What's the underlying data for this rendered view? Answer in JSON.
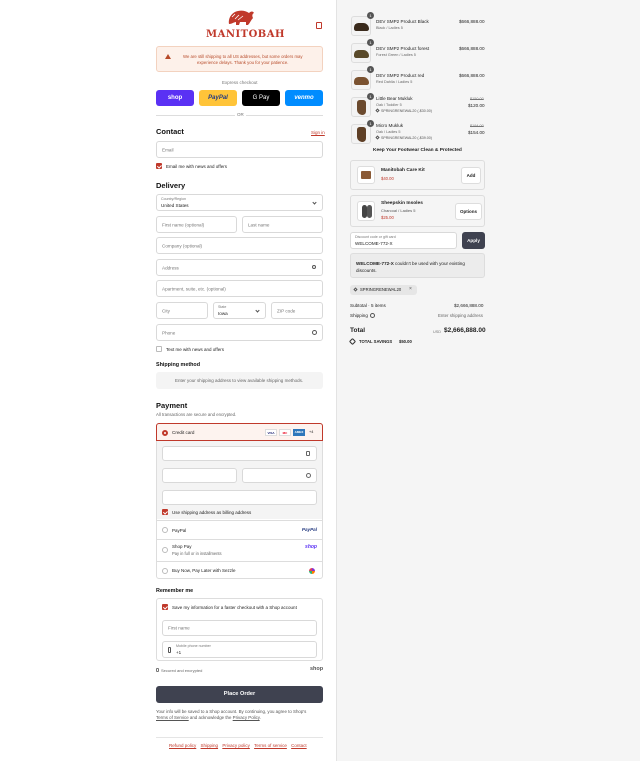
{
  "brand": {
    "name": "MANITOBAH"
  },
  "banner": {
    "text1": "We are still shipping to all US addresses, but some orders may",
    "text2": "experience delays. Thank you for your patience."
  },
  "express": {
    "title": "Express checkout",
    "or": "OR",
    "shop": "shop",
    "paypal": "PayPal",
    "gpay": "G Pay",
    "venmo": "venmo"
  },
  "contact": {
    "heading": "Contact",
    "signin": "Sign in",
    "email_ph": "Email",
    "news": "Email me with news and offers"
  },
  "delivery": {
    "heading": "Delivery",
    "country_label": "Country/Region",
    "country": "United States",
    "first": "First name (optional)",
    "last": "Last name",
    "company": "Company (optional)",
    "address": "Address",
    "apt": "Apartment, suite, etc. (optional)",
    "city": "City",
    "state_label": "State",
    "state": "Iowa",
    "zip": "ZIP code",
    "phone": "Phone",
    "text_me": "Text me with news and offers"
  },
  "shipping": {
    "heading": "Shipping method",
    "placeholder": "Enter your shipping address to view available shipping methods."
  },
  "payment": {
    "heading": "Payment",
    "subtitle": "All transactions are secure and encrypted.",
    "credit": "Credit card",
    "cards": [
      "VISA",
      "MC",
      "AMEX",
      "+4"
    ],
    "billing": "Use shipping address as billing address",
    "paypal": "PayPal",
    "paypal_logo": "PayPal",
    "shoppay": "Shop Pay",
    "shoppay_sub": "Pay in full or in installments",
    "shoppay_logo": "shop",
    "sezzle": "Buy Now, Pay Later with Sezzle"
  },
  "remember": {
    "heading": "Remember me",
    "save": "Save my information for a faster checkout with a Shop account",
    "first": "First name",
    "phone_label": "Mobile phone number",
    "phone_value": "+1",
    "secure": "Secured and encrypted",
    "shop_logo": "shop"
  },
  "place_order": "Place Order",
  "legal": {
    "line1": "Your info will be saved to a Shop account. By continuing, you agree to Shop's",
    "terms": "Terms of Service",
    "mid": " and acknowledge the ",
    "privacy": "Privacy Policy",
    "end": "."
  },
  "footer": [
    "Refund policy",
    "Shipping",
    "Privacy policy",
    "Terms of service",
    "Contact"
  ],
  "items": [
    {
      "qty": "1",
      "name": "DEV SMP2 Product Black",
      "variant": "Black / Ladies 5",
      "price": "$666,888.00",
      "kind": "shoe",
      "shoe_color": "#3a2a1c"
    },
    {
      "qty": "1",
      "name": "DEV SMP2 Product forest",
      "variant": "Forest Green / Ladies 5",
      "price": "$666,888.00",
      "kind": "shoe",
      "shoe_color": "#5a4a2a"
    },
    {
      "qty": "1",
      "name": "DEV SMP2 Product red",
      "variant": "Red Dahlia / Ladies 5",
      "price": "$666,888.00",
      "kind": "shoe",
      "shoe_color": "#7a5230"
    },
    {
      "qty": "1",
      "name": "Little Bear Mukluk",
      "variant": "Oak / Toddler 5",
      "discount": "SPRINGRENEWAL20 (-$30.00)",
      "old": "$150.00",
      "price": "$120.00",
      "kind": "boot"
    },
    {
      "qty": "1",
      "name": "Micro Mukluk",
      "variant": "Oak / Ladies 5",
      "discount": "SPRINGRENEWAL20 (-$39.00)",
      "old": "$194.00",
      "price": "$154.00",
      "kind": "boot"
    }
  ],
  "upsell": {
    "heading": "Keep Your Footwear Clean & Protected",
    "items": [
      {
        "name": "Manitobah Care Kit",
        "price": "$40.00",
        "button": "Add"
      },
      {
        "name": "Sheepskin Insoles",
        "variant": "Charcoal / Ladies 5",
        "price": "$25.00",
        "button": "Options"
      }
    ]
  },
  "discount": {
    "label": "Discount code or gift card",
    "value": "WELCOME-772-X",
    "apply": "Apply",
    "error_code": "WELCOME-772-X",
    "error_rest": " couldn't be used with your existing",
    "error_line2": "discounts.",
    "tag": "SPRINGRENEWAL20"
  },
  "summary": {
    "subtotal_label": "Subtotal · 5 items",
    "subtotal": "$2,666,888.00",
    "shipping_label": "Shipping",
    "shipping": "Enter shipping address",
    "total_label": "Total",
    "currency": "USD",
    "total": "$2,666,888.00",
    "savings_label": "TOTAL SAVINGS",
    "savings": "$50.00"
  },
  "colors": {
    "accent": "#c0392b",
    "shop": "#5a31f4",
    "paypal": "#ffc439",
    "venmo": "#008cff",
    "button_dark": "#3f4250"
  }
}
